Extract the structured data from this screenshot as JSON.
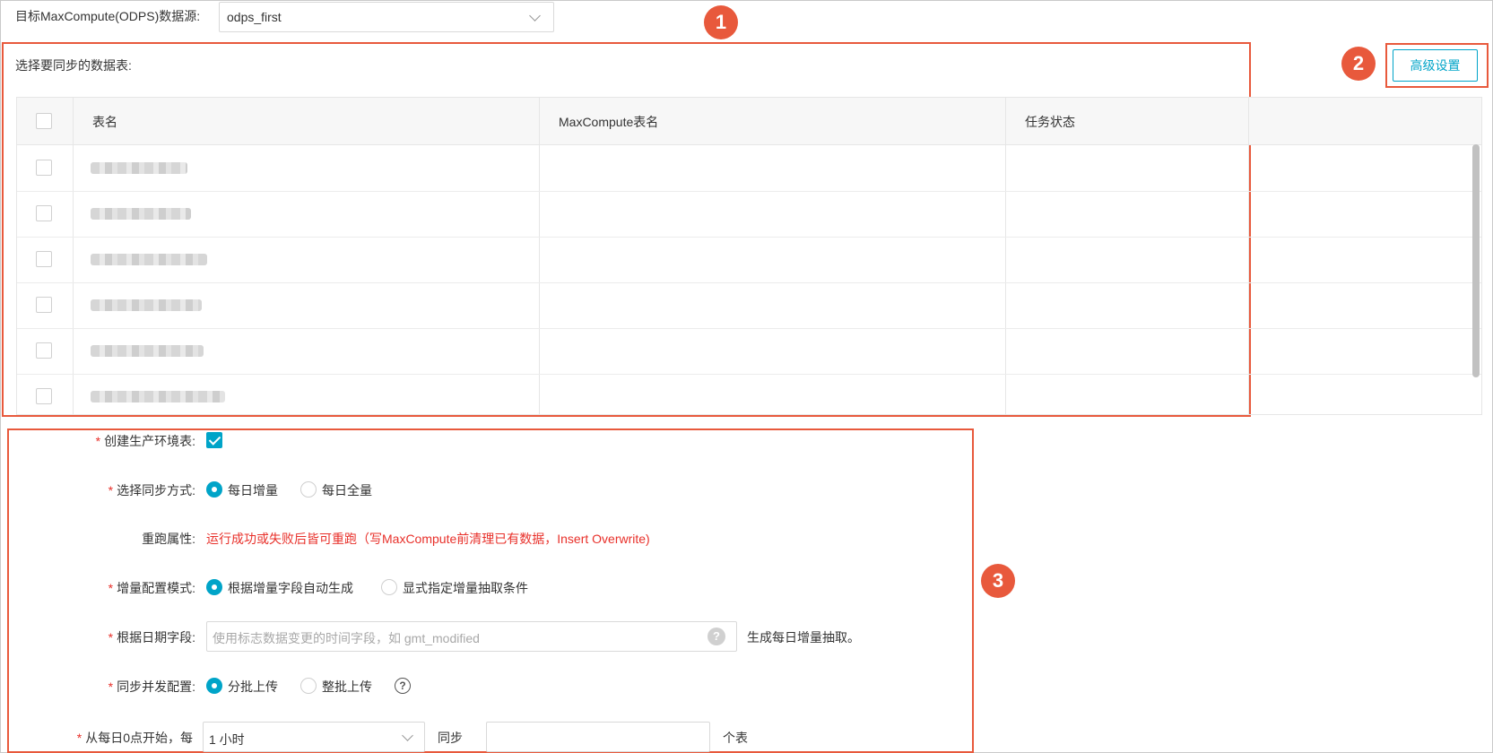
{
  "datasource": {
    "label": "目标MaxCompute(ODPS)数据源:",
    "value": "odps_first"
  },
  "badges": [
    "1",
    "2",
    "3"
  ],
  "table_section": {
    "label": "选择要同步的数据表:",
    "advanced_button": "高级设置",
    "columns": [
      "表名",
      "MaxCompute表名",
      "任务状态"
    ],
    "rows": [
      {
        "name": "",
        "mc_name": "",
        "status": ""
      },
      {
        "name": "",
        "mc_name": "",
        "status": ""
      },
      {
        "name": "",
        "mc_name": "",
        "status": ""
      },
      {
        "name": "",
        "mc_name": "",
        "status": ""
      },
      {
        "name": "",
        "mc_name": "",
        "status": ""
      },
      {
        "name": "",
        "mc_name": "",
        "status": ""
      }
    ]
  },
  "form": {
    "create_prod_table": {
      "label": "创建生产环境表:",
      "required": "*",
      "checked": true
    },
    "sync_mode": {
      "label": "选择同步方式:",
      "required": "*",
      "options": [
        "每日增量",
        "每日全量"
      ],
      "selected": "每日增量"
    },
    "rerun": {
      "label": "重跑属性:",
      "value": "运行成功或失败后皆可重跑（写MaxCompute前清理已有数据，Insert Overwrite)"
    },
    "incr_mode": {
      "label": "增量配置模式:",
      "required": "*",
      "options": [
        "根据增量字段自动生成",
        "显式指定增量抽取条件"
      ],
      "selected": "根据增量字段自动生成"
    },
    "date_field": {
      "label": "根据日期字段:",
      "required": "*",
      "placeholder": "使用标志数据变更的时间字段，如 gmt_modified",
      "suffix": "生成每日增量抽取。",
      "help": "?"
    },
    "concurrency": {
      "label": "同步并发配置:",
      "required": "*",
      "options": [
        "分批上传",
        "整批上传"
      ],
      "selected": "分批上传",
      "help": "?"
    },
    "schedule": {
      "label": "从每日0点开始，每",
      "required": "*",
      "interval": "1 小时",
      "mid": "同步",
      "count": "",
      "suffix": "个表"
    }
  },
  "colors": {
    "accent": "#00a4c8",
    "annotation": "#e8593c",
    "required": "#e8302a",
    "warning_text": "#e8302a"
  }
}
